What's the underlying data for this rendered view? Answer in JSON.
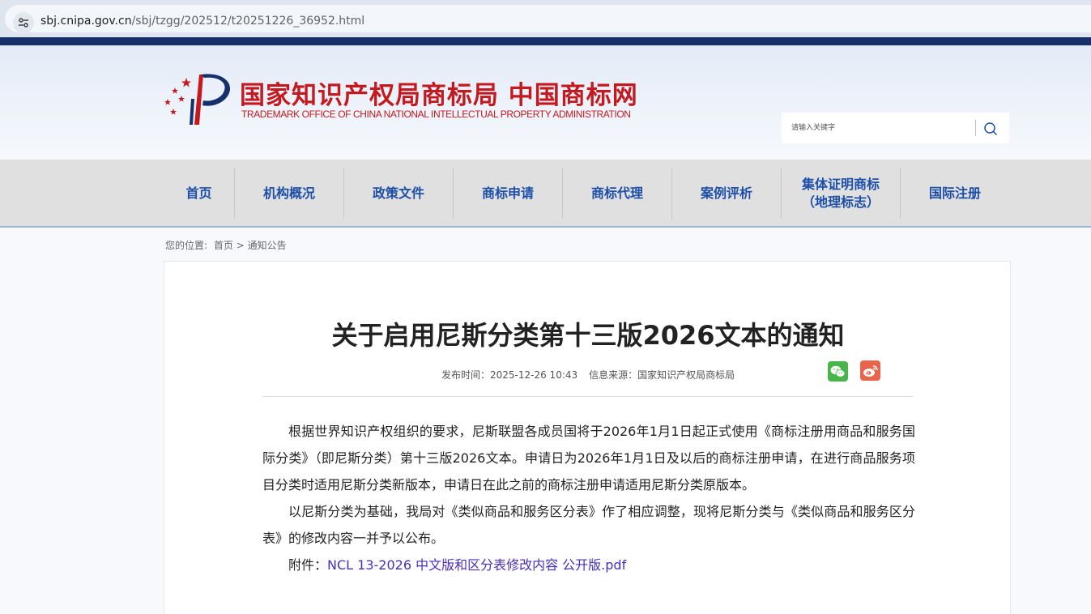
{
  "browser": {
    "url_domain": "sbj.cnipa.gov.cn",
    "url_path": "/sbj/tzgg/202512/t20251226_36952.html"
  },
  "header": {
    "logo_cn": "国家知识产权局商标局 中国商标网",
    "logo_en": "TRADEMARK OFFICE OF CHINA NATIONAL INTELLECTUAL PROPERTY ADMINISTRATION",
    "search_placeholder": "请输入关键字"
  },
  "nav": {
    "items": [
      {
        "label": "首页"
      },
      {
        "label": "机构概况"
      },
      {
        "label": "政策文件"
      },
      {
        "label": "商标申请"
      },
      {
        "label": "商标代理"
      },
      {
        "label": "案例评析"
      },
      {
        "label": "集体证明商标\n（地理标志）"
      },
      {
        "label": "国际注册"
      }
    ]
  },
  "breadcrumb": {
    "prefix": "您的位置:",
    "home": "首页 >",
    "current": "通知公告"
  },
  "article": {
    "title": "关于启用尼斯分类第十三版2026文本的通知",
    "publish_time": "发布时间：2025-12-26 10:43",
    "source": "信息来源：国家知识产权局商标局",
    "paragraphs": [
      "根据世界知识产权组织的要求，尼斯联盟各成员国将于2026年1月1日起正式使用《商标注册用商品和服务国际分类》（即尼斯分类）第十三版2026文本。申请日为2026年1月1日及以后的商标注册申请，在进行商品服务项目分类时适用尼斯分类新版本，申请日在此之前的商标注册申请适用尼斯分类原版本。",
      "以尼斯分类为基础，我局对《类似商品和服务区分表》作了相应调整，现将尼斯分类与《类似商品和服务区分表》的修改内容一并予以公布。"
    ],
    "attachment_label": "附件：",
    "attachment_link": "NCL 13-2026 中文版和区分表修改内容 公开版.pdf"
  },
  "colors": {
    "brand_red": "#c4191f",
    "nav_text": "#1d4fa8",
    "navy_band": "#16306b",
    "link": "#4b2dbb",
    "wechat": "#48b54a",
    "weibo": "#e8644a"
  },
  "icons": [
    "site-info-icon",
    "search-icon",
    "wechat-icon",
    "weibo-icon"
  ]
}
